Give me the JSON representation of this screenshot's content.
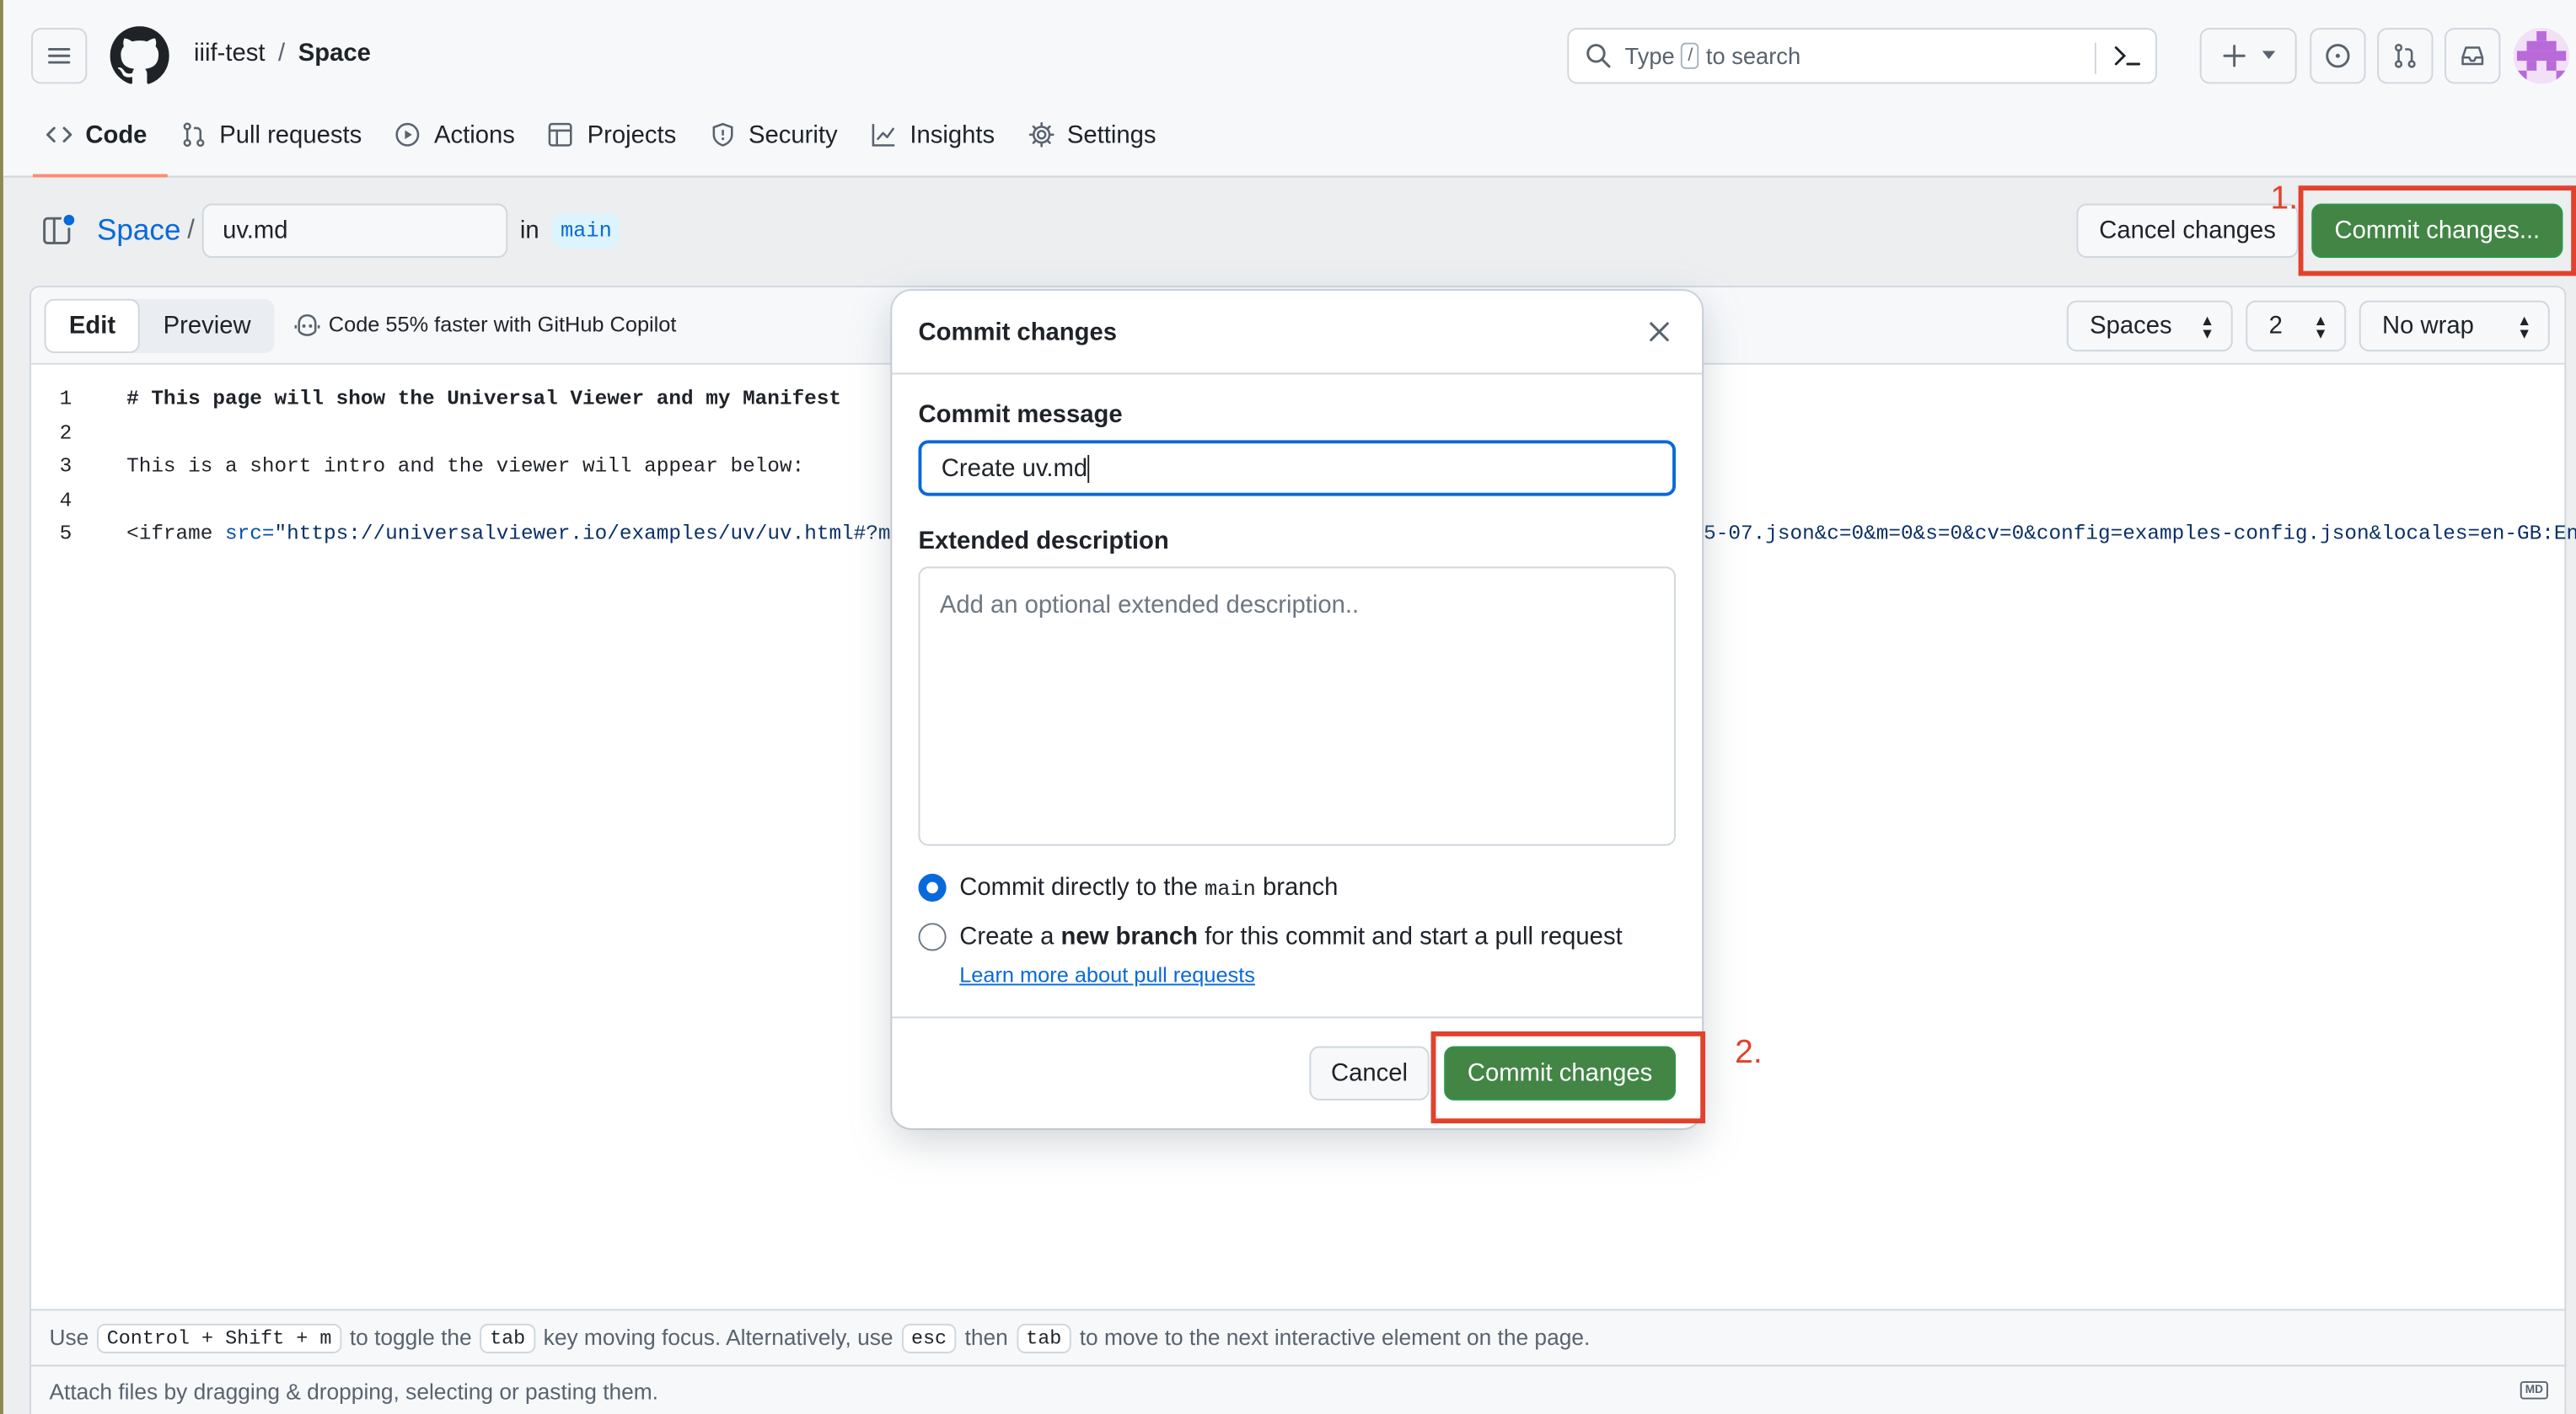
{
  "header": {
    "owner": "iiif-test",
    "separator": "/",
    "repo": "Space",
    "search_prefix": "Type",
    "search_key": "/",
    "search_suffix": "to search"
  },
  "tabs": [
    {
      "label": "Code",
      "icon": "code-icon"
    },
    {
      "label": "Pull requests",
      "icon": "git-pull-request-icon"
    },
    {
      "label": "Actions",
      "icon": "play-icon"
    },
    {
      "label": "Projects",
      "icon": "table-icon"
    },
    {
      "label": "Security",
      "icon": "shield-icon"
    },
    {
      "label": "Insights",
      "icon": "graph-icon"
    },
    {
      "label": "Settings",
      "icon": "gear-icon"
    }
  ],
  "editor_bar": {
    "repo_link": "Space",
    "slash": "/",
    "filename": "uv.md",
    "in_label": "in",
    "branch": "main",
    "cancel_label": "Cancel changes",
    "commit_label": "Commit changes..."
  },
  "editor_toolbar": {
    "edit": "Edit",
    "preview": "Preview",
    "copilot": "Code 55% faster with GitHub Copilot",
    "indent_mode": "Spaces",
    "indent_size": "2",
    "wrap_mode": "No wrap"
  },
  "code_lines": [
    {
      "num": "1",
      "text": "# This page will show the Universal Viewer and my Manifest"
    },
    {
      "num": "2",
      "text": ""
    },
    {
      "num": "3",
      "text": "This is a short intro and the viewer will appear below:"
    },
    {
      "num": "4",
      "text": ""
    },
    {
      "num": "5",
      "tag_open": "<iframe ",
      "attr": "src=",
      "str": "\"https://universalviewer.io/examples/uv/uv.html#?ma",
      "tail": "5-07.json&c=0&m=0&s=0&cv=0&config=examples-config.json&locales=en-GB:En"
    }
  ],
  "hint": {
    "use": "Use",
    "shortcut": "Control + Shift + m",
    "to_toggle": "to toggle the",
    "tab_key": "tab",
    "moving": "key moving focus. Alternatively, use",
    "esc_key": "esc",
    "then": "then",
    "tab_key2": "tab",
    "rest": "to move to the next interactive element on the page."
  },
  "attach_text": "Attach files by dragging & dropping, selecting or pasting them.",
  "markdown_badge": "MD",
  "modal": {
    "title": "Commit changes",
    "message_label": "Commit message",
    "message_value": "Create uv.md",
    "description_label": "Extended description",
    "description_placeholder": "Add an optional extended description..",
    "option1_pre": "Commit directly to the",
    "option1_branch": "main",
    "option1_post": "branch",
    "option2_pre": "Create a",
    "option2_bold": "new branch",
    "option2_post": "for this commit and start a pull request",
    "learn_more": "Learn more about pull requests",
    "cancel_label": "Cancel",
    "commit_label": "Commit changes"
  },
  "annotations": {
    "step1": "1.",
    "step2": "2."
  },
  "colors": {
    "accent_blue": "#0969da",
    "primary_green": "#428545",
    "annotation_red": "#e2412d"
  }
}
